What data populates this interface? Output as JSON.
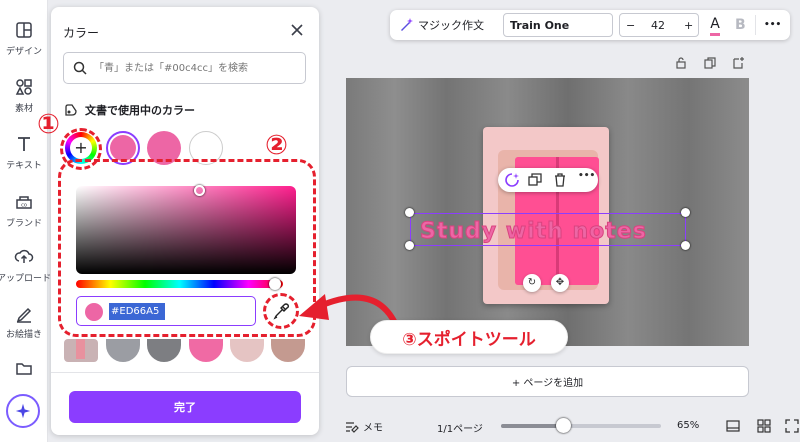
{
  "rail": {
    "items": [
      {
        "label": "デザイン",
        "icon": "layout-icon"
      },
      {
        "label": "素材",
        "icon": "shapes-icon"
      },
      {
        "label": "テキスト",
        "icon": "text-icon"
      },
      {
        "label": "ブランド",
        "icon": "brand-icon"
      },
      {
        "label": "アップロード",
        "icon": "upload-icon"
      },
      {
        "label": "お絵描き",
        "icon": "draw-icon"
      },
      {
        "label": "",
        "icon": "folder-icon"
      }
    ]
  },
  "panel": {
    "title": "カラー",
    "search_placeholder": "「青」または「#00c4cc」を検索",
    "doc_colors_label": "文書で使用中のカラー",
    "doc_swatches": [
      "#ed66a5",
      "#ed66a5",
      "#ffffff"
    ],
    "hex_value": "#ED66A5",
    "photo_swatches": [
      "#e8919e",
      "#9b9da3",
      "#7d7e82",
      "#f06aa4",
      "#e5c4c3",
      "#c49a90"
    ],
    "done_label": "完了"
  },
  "annotations": {
    "one": "①",
    "two": "②",
    "three_label": "③スポイトツール"
  },
  "toolbar": {
    "magic_label": "マジック作文",
    "font_name": "Train One",
    "minus": "−",
    "font_size": "42",
    "plus": "+",
    "text_color_letter": "A",
    "bold_letter": "B",
    "more": "•••"
  },
  "canvas": {
    "text": "Study with notes"
  },
  "add_page_label": "+ ページを追加",
  "footer": {
    "notes_label": "メモ",
    "page_indicator": "1/1ページ",
    "zoom": "65%",
    "zoom_level": 0.65
  },
  "colors": {
    "accent": "#8b3dff",
    "annotation": "#e5202e",
    "text_color": "#ed66a5"
  }
}
